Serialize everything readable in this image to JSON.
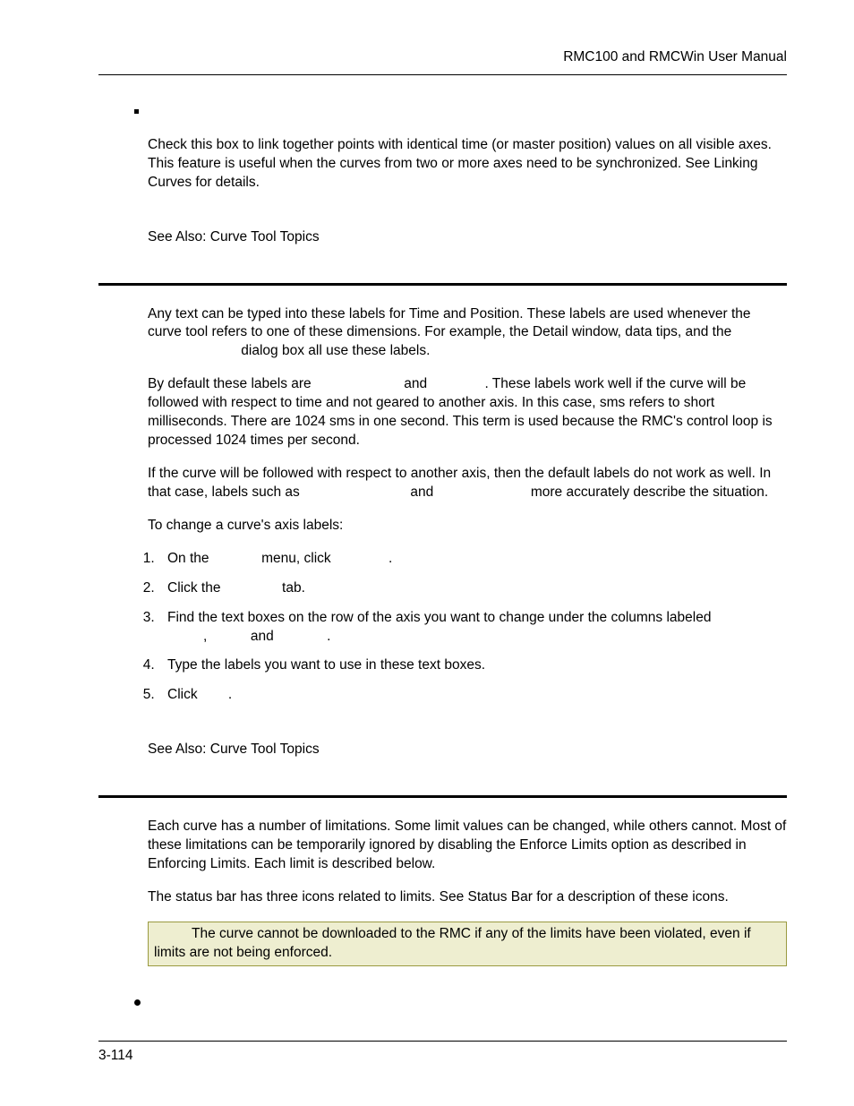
{
  "header": {
    "title": "RMC100 and RMCWin User Manual"
  },
  "section1": {
    "para1": "Check this box to link together points with identical time (or master position) values on all visible axes. This feature is useful when the curves from two or more axes need to be synchronized. See Linking Curves for details.",
    "seeAlso": "See Also: Curve Tool Topics"
  },
  "section2": {
    "para1_a": "Any text can be typed into these labels for Time and Position. These labels are used whenever the curve tool refers to one of these dimensions. For example, the Detail window, data tips, and the ",
    "para1_b": " dialog box all use these labels.",
    "para2_a": "By default these labels are ",
    "para2_b": " and ",
    "para2_c": ". These labels work well if the curve will be followed with respect to time and not geared to another axis. In this case, sms refers to short milliseconds. There are 1024 sms in one second. This term is used because the RMC's control loop is processed 1024 times per second.",
    "para3_a": "If the curve will be followed with respect to another axis, then the default labels do not work as well. In that case, labels such as ",
    "para3_b": " and ",
    "para3_c": " more accurately describe the situation.",
    "para4": "To change a curve's axis labels:",
    "steps": {
      "s1_a": "On the ",
      "s1_b": " menu, click ",
      "s1_c": ".",
      "s2_a": "Click the ",
      "s2_b": " tab.",
      "s3_a": "Find the text boxes on the row of the axis you want to change under the columns labeled ",
      "s3_b": ", ",
      "s3_c": " and ",
      "s3_d": ".",
      "s4": "Type the labels you want to use in these text boxes.",
      "s5_a": "Click ",
      "s5_b": "."
    },
    "seeAlso": "See Also: Curve Tool Topics"
  },
  "section3": {
    "para1": "Each curve has a number of limitations. Some limit values can be changed, while others cannot. Most of these limitations can be temporarily ignored by disabling the Enforce Limits option as described in Enforcing Limits. Each limit is described below.",
    "para2": "The status bar has three icons related to limits. See Status Bar for a description of these icons.",
    "note": " The curve cannot be downloaded to the RMC if any of the limits have been violated, even if limits are not being enforced."
  },
  "footer": {
    "pageNum": "3-114"
  }
}
